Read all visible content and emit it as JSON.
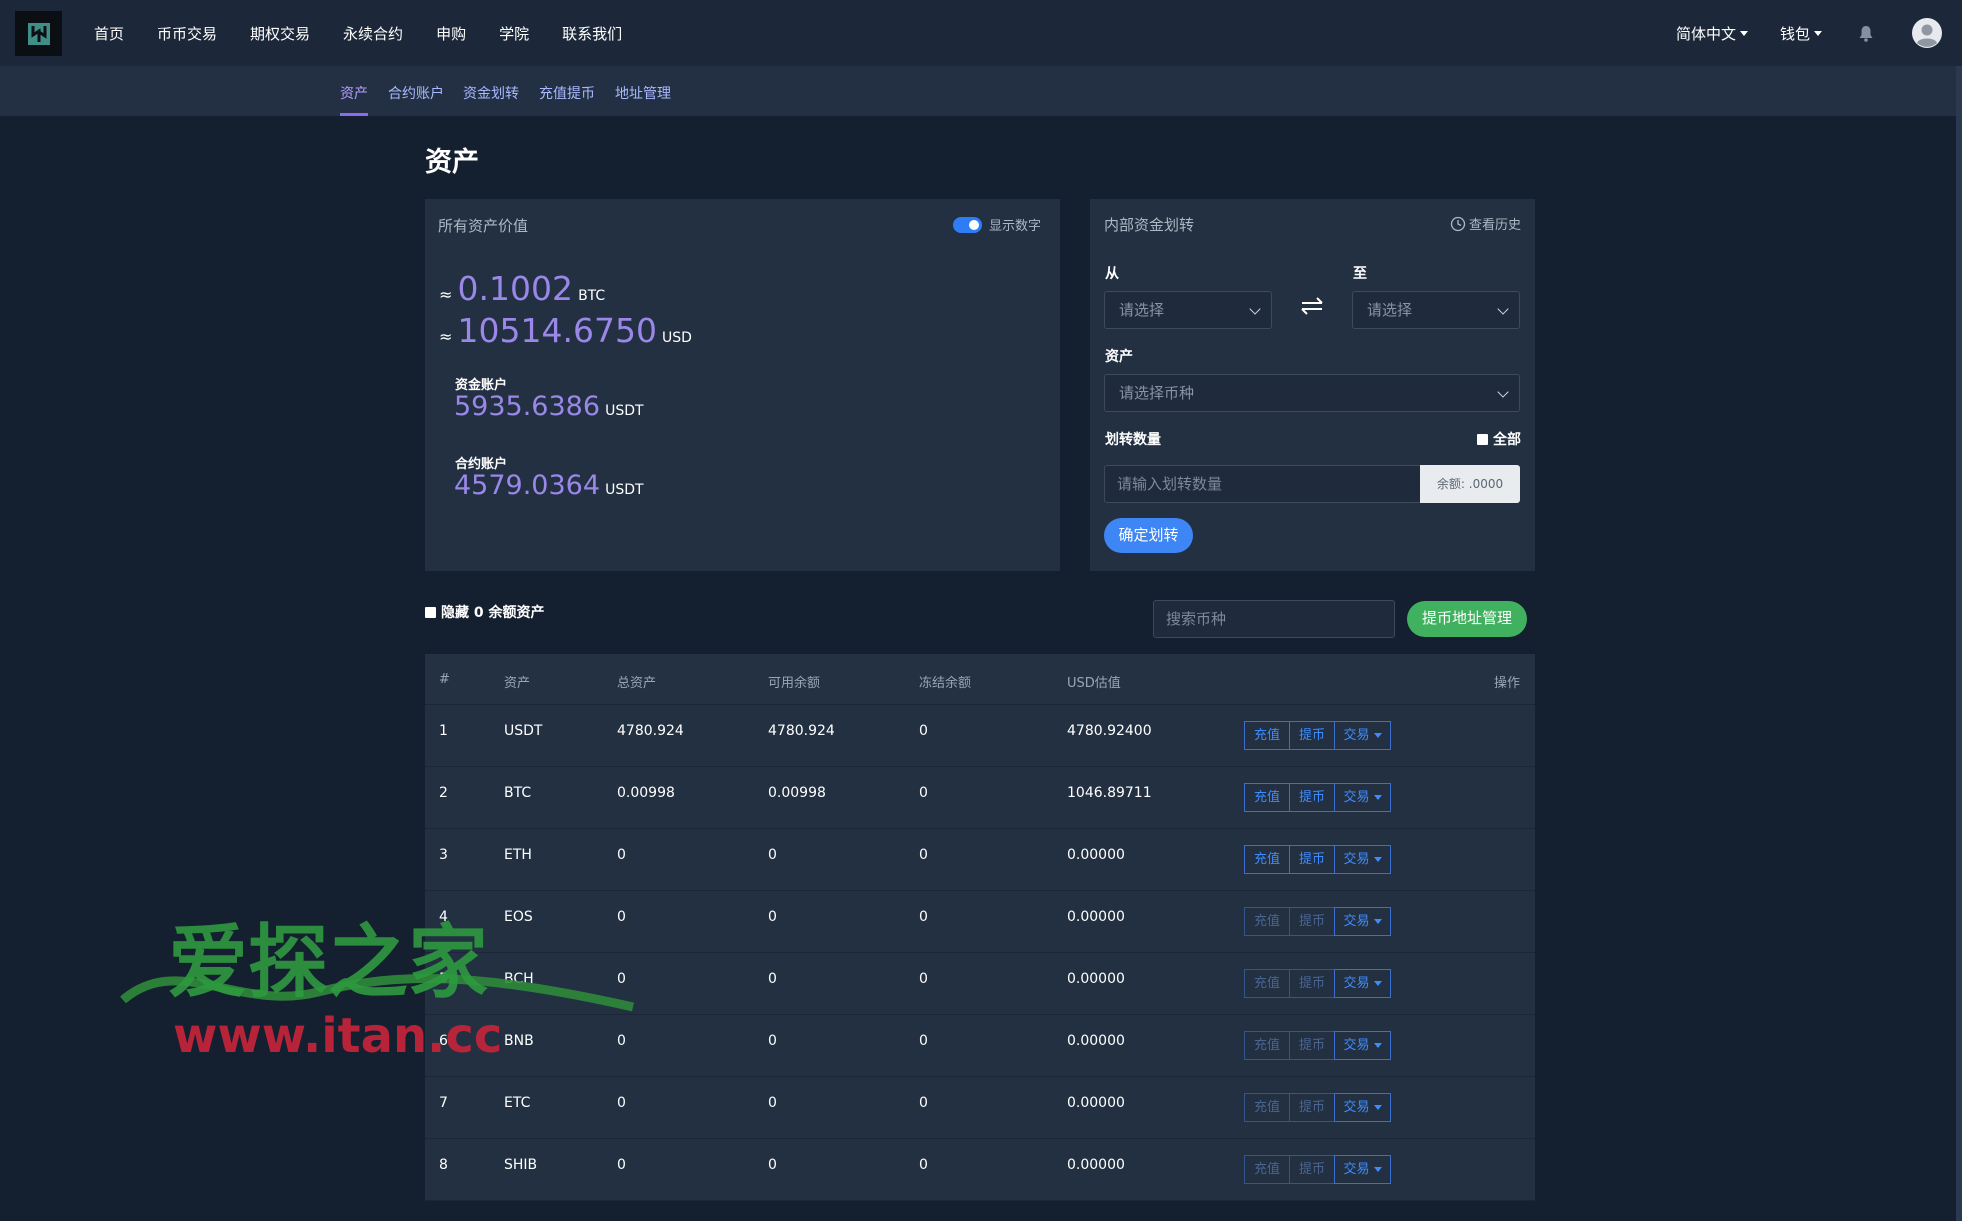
{
  "nav": {
    "items": [
      "首页",
      "币币交易",
      "期权交易",
      "永续合约",
      "申购",
      "学院",
      "联系我们"
    ],
    "language": "简体中文",
    "wallet": "钱包"
  },
  "subnav": {
    "items": [
      "资产",
      "合约账户",
      "资金划转",
      "充值提币",
      "地址管理"
    ],
    "active": "资产"
  },
  "page": {
    "title": "资产"
  },
  "assets_card": {
    "title": "所有资产价值",
    "toggle_label": "显示数字",
    "approx": "≈",
    "btc_value": "0.1002",
    "btc_unit": "BTC",
    "usd_value": "10514.6750",
    "usd_unit": "USD",
    "fund_label": "资金账户",
    "fund_value": "5935.6386",
    "fund_unit": "USDT",
    "contract_label": "合约账户",
    "contract_value": "4579.0364",
    "contract_unit": "USDT"
  },
  "transfer_card": {
    "title": "内部资金划转",
    "history": "查看历史",
    "from_label": "从",
    "to_label": "至",
    "from_placeholder": "请选择",
    "to_placeholder": "请选择",
    "asset_label": "资产",
    "asset_placeholder": "请选择币种",
    "amount_label": "划转数量",
    "all_label": "全部",
    "amount_placeholder": "请输入划转数量",
    "balance": "余额: .0000",
    "confirm": "确定划转"
  },
  "toolbar": {
    "hide_zero": "隐藏 0 余额资产",
    "search_placeholder": "搜索币种",
    "address_btn": "提币地址管理"
  },
  "table": {
    "columns": [
      "#",
      "资产",
      "总资产",
      "可用余额",
      "冻结余额",
      "USD估值",
      "操作"
    ],
    "rows": [
      {
        "no": "1",
        "asset": "USDT",
        "total": "4780.924",
        "available": "4780.924",
        "frozen": "0",
        "usd": "4780.92400",
        "enabled": true
      },
      {
        "no": "2",
        "asset": "BTC",
        "total": "0.00998",
        "available": "0.00998",
        "frozen": "0",
        "usd": "1046.89711",
        "enabled": true
      },
      {
        "no": "3",
        "asset": "ETH",
        "total": "0",
        "available": "0",
        "frozen": "0",
        "usd": "0.00000",
        "enabled": true
      },
      {
        "no": "4",
        "asset": "EOS",
        "total": "0",
        "available": "0",
        "frozen": "0",
        "usd": "0.00000",
        "enabled": false
      },
      {
        "no": "5",
        "asset": "BCH",
        "total": "0",
        "available": "0",
        "frozen": "0",
        "usd": "0.00000",
        "enabled": false
      },
      {
        "no": "6",
        "asset": "BNB",
        "total": "0",
        "available": "0",
        "frozen": "0",
        "usd": "0.00000",
        "enabled": false
      },
      {
        "no": "7",
        "asset": "ETC",
        "total": "0",
        "available": "0",
        "frozen": "0",
        "usd": "0.00000",
        "enabled": false
      },
      {
        "no": "8",
        "asset": "SHIB",
        "total": "0",
        "available": "0",
        "frozen": "0",
        "usd": "0.00000",
        "enabled": false
      }
    ],
    "deposit": "充值",
    "withdraw": "提币",
    "trade": "交易"
  },
  "watermark": {
    "title": "爱探之家",
    "url": "www.itan.cc"
  },
  "colors": {
    "accent_purple": "#9a87e8",
    "primary_blue": "#3e86f5",
    "green": "#3fb15f",
    "background": "#141f2f"
  }
}
